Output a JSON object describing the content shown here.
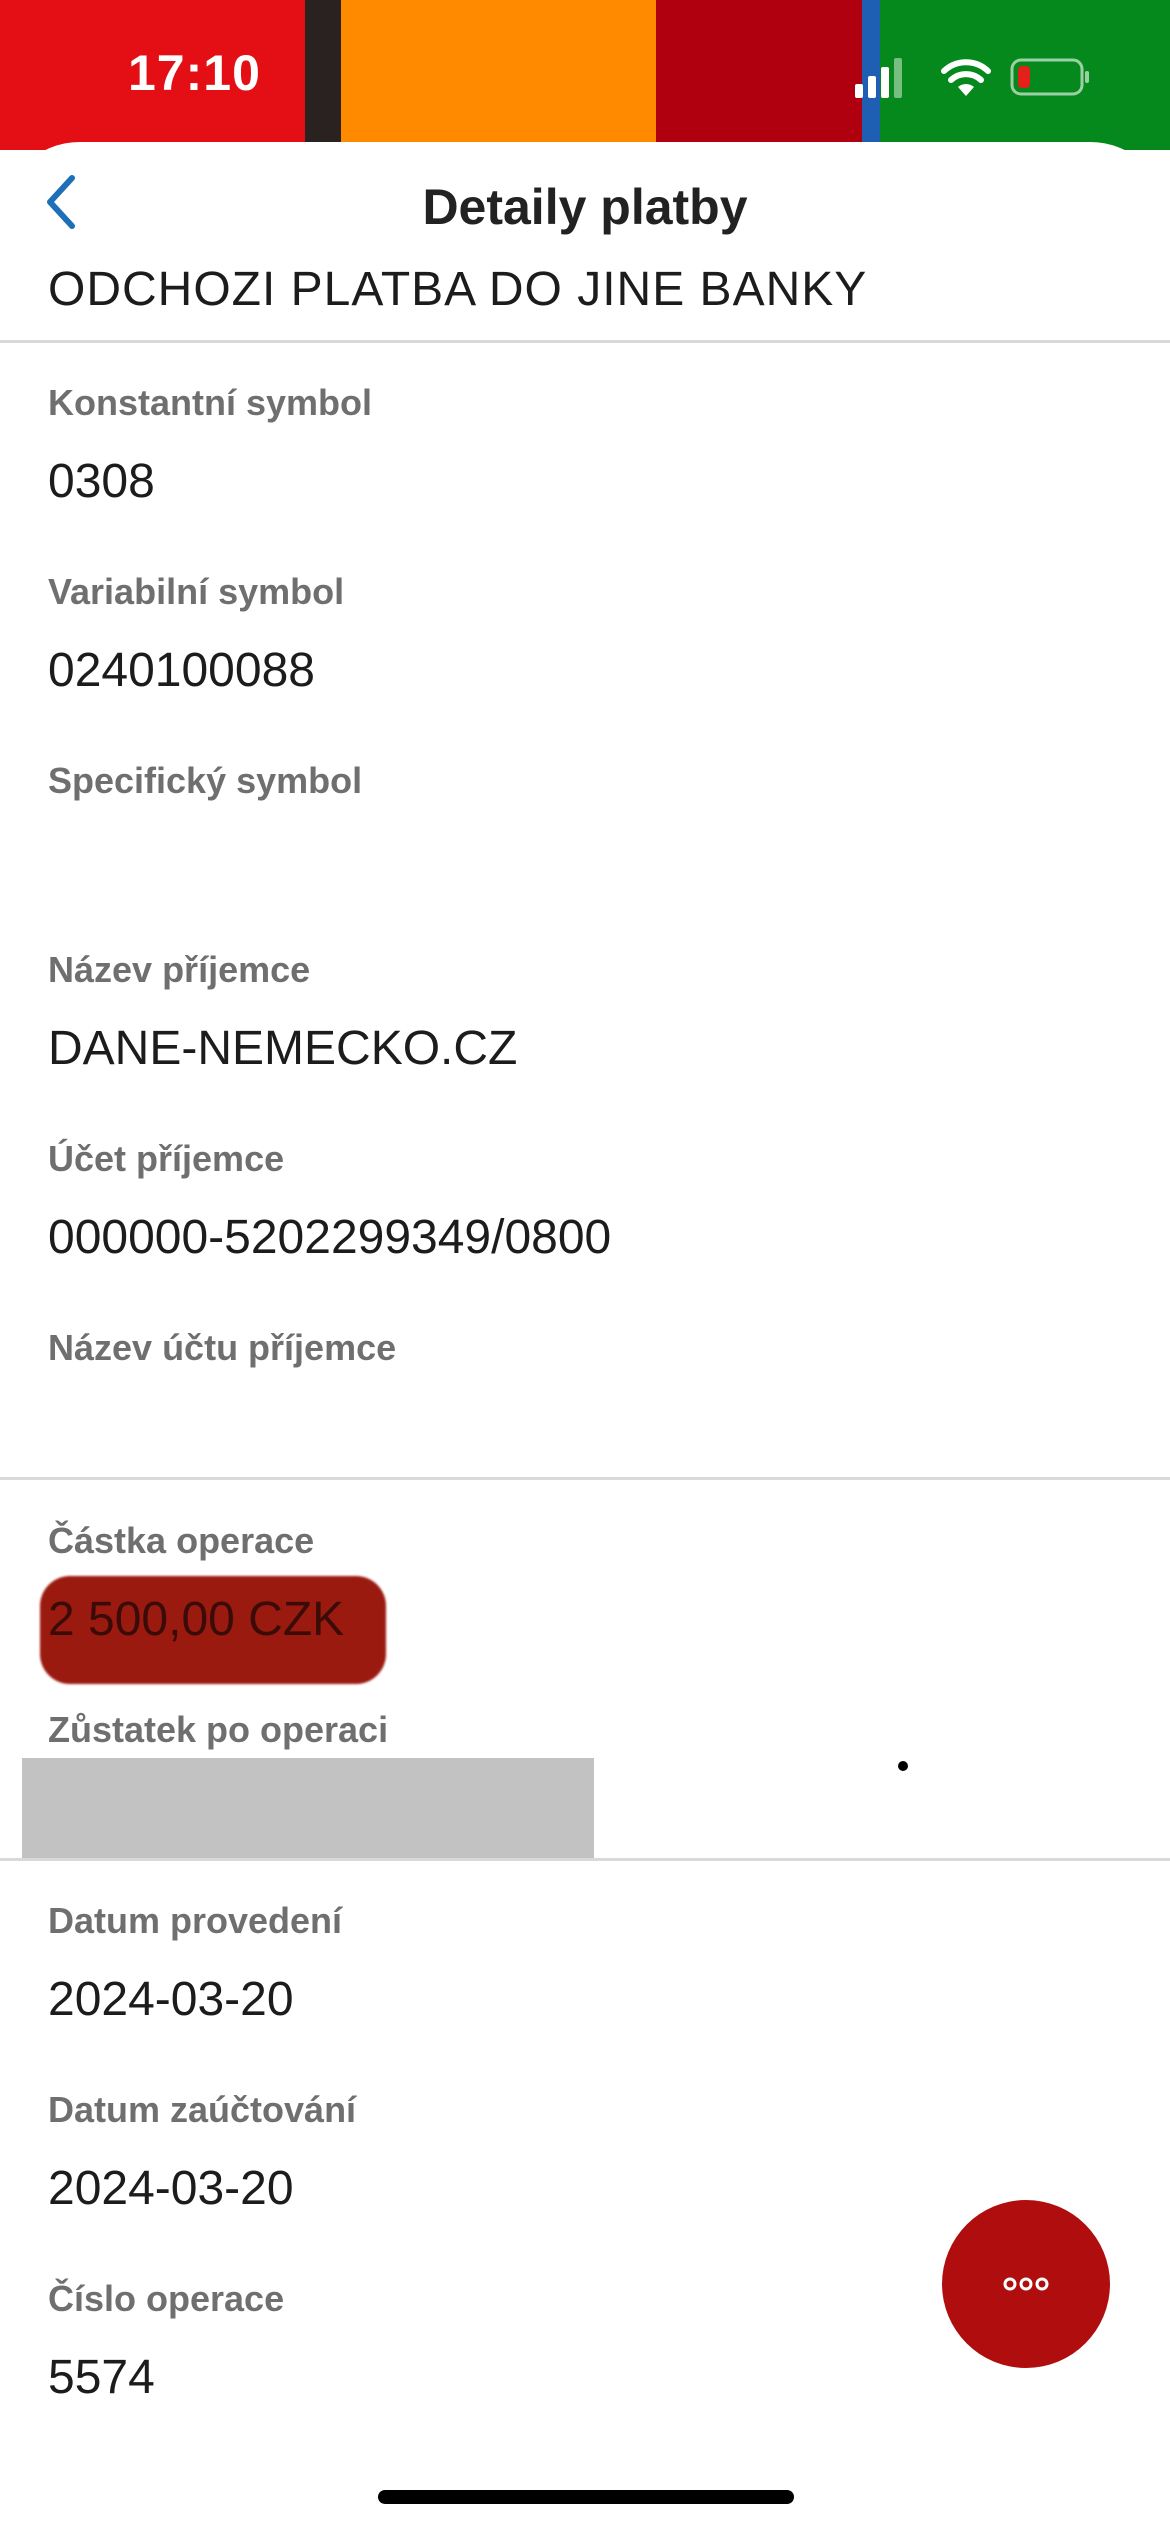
{
  "status_bar": {
    "time": "17:10",
    "stripe_colors": [
      "#e30f14",
      "#2a2220",
      "#ff8a00",
      "#b00010",
      "#1e5fb4",
      "#06891c"
    ],
    "signal_icon": "cellular-signal-icon",
    "wifi_icon": "wifi-icon",
    "battery_icon": "battery-low-icon"
  },
  "header": {
    "title": "Detaily platby",
    "back_icon": "chevron-left-icon",
    "transaction_type": "ODCHOZI PLATBA DO JINE BANKY"
  },
  "fields": {
    "constant_symbol": {
      "label": "Konstantní symbol",
      "value": "0308"
    },
    "variable_symbol": {
      "label": "Variabilní symbol",
      "value": "0240100088"
    },
    "specific_symbol": {
      "label": "Specifický symbol",
      "value": ""
    },
    "recipient_name": {
      "label": "Název příjemce",
      "value": "DANE-NEMECKO.CZ"
    },
    "recipient_account": {
      "label": "Účet příjemce",
      "value": "000000-5202299349/0800"
    },
    "recipient_account_name": {
      "label": "Název účtu příjemce",
      "value": ""
    },
    "amount": {
      "label": "Částka operace",
      "value": "2 500,00 CZK"
    },
    "balance_after": {
      "label": "Zůstatek po operaci",
      "value": ""
    },
    "execution_date": {
      "label": "Datum provedení",
      "value": "2024-03-20"
    },
    "posting_date": {
      "label": "Datum zaúčtování",
      "value": "2024-03-20"
    },
    "operation_number": {
      "label": "Číslo operace",
      "value": "5574"
    }
  },
  "actions": {
    "more_icon": "more-options-icon"
  },
  "colors": {
    "accent_red": "#b00e0e",
    "back_blue": "#1e6fb8",
    "label_gray": "#6f6f6f"
  }
}
